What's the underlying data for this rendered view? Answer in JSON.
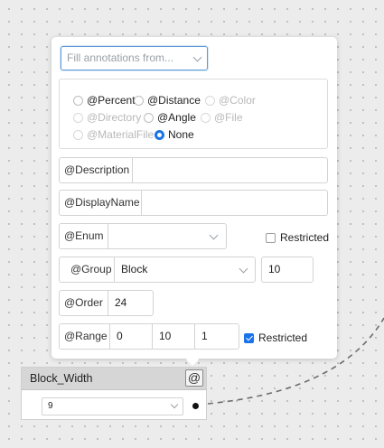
{
  "annotations": {
    "fill_placeholder": "Fill annotations from...",
    "types": [
      {
        "label": "@Percent",
        "enabled": true,
        "selected": false
      },
      {
        "label": "@Distance",
        "enabled": true,
        "selected": false
      },
      {
        "label": "@Color",
        "enabled": false,
        "selected": false
      },
      {
        "label": "@Directory",
        "enabled": false,
        "selected": false
      },
      {
        "label": "@Angle",
        "enabled": true,
        "selected": false
      },
      {
        "label": "@File",
        "enabled": false,
        "selected": false
      },
      {
        "label": "@MaterialFile",
        "enabled": false,
        "selected": false
      },
      {
        "label": "None",
        "enabled": true,
        "selected": true
      }
    ],
    "description": {
      "label": "@Description",
      "value": ""
    },
    "display_name": {
      "label": "@DisplayName",
      "value": ""
    },
    "enum": {
      "label": "@Enum",
      "value": "",
      "restricted_label": "Restricted",
      "restricted": false
    },
    "group": {
      "label": "@Group",
      "value": "Block",
      "number": "10"
    },
    "order": {
      "label": "@Order",
      "value": "24"
    },
    "range": {
      "label": "@Range",
      "min": "0",
      "max": "10",
      "step": "1",
      "restricted_label": "Restricted",
      "restricted": true
    }
  },
  "node": {
    "title": "Block_Width",
    "annotation_button": "@",
    "value": "9"
  },
  "icons": {
    "annotation_button": "at-sign-icon",
    "dropdown": "chevron-down-icon",
    "output_port": "port-dot-icon"
  },
  "colors": {
    "accent": "#1a73e8",
    "focus_border": "#5b9bd5",
    "node_header": "#d6d6d6",
    "canvas": "#ececec",
    "wire": "#6d6d6d"
  }
}
